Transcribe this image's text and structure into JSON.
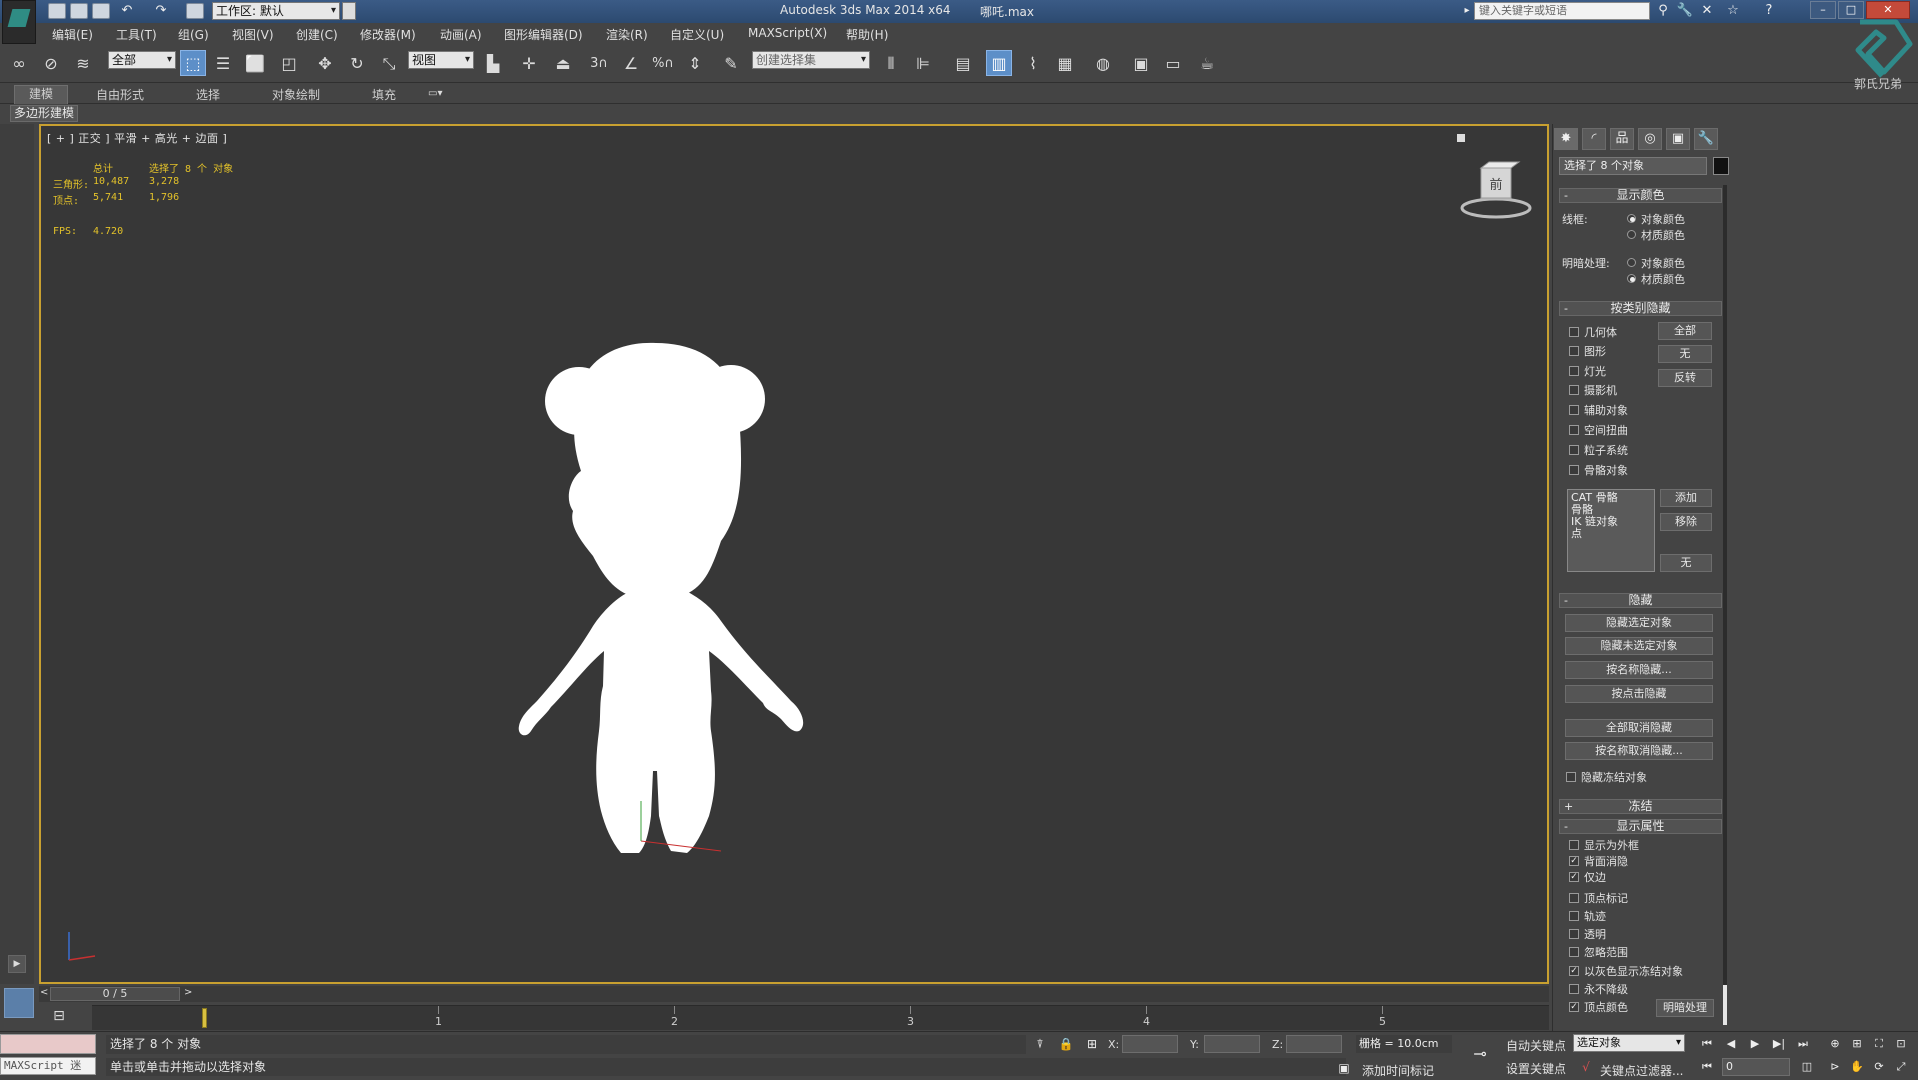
{
  "titlebar": {
    "workspace": "工作区: 默认",
    "app_title": "Autodesk 3ds Max  2014 x64",
    "file_name": "哪吒.max",
    "search_placeholder": "键入关键字或短语"
  },
  "menu": [
    "编辑(E)",
    "工具(T)",
    "组(G)",
    "视图(V)",
    "创建(C)",
    "修改器(M)",
    "动画(A)",
    "图形编辑器(D)",
    "渲染(R)",
    "自定义(U)",
    "MAXScript(X)",
    "帮助(H)"
  ],
  "toolbar": {
    "filter": "全部",
    "coord_system": "视图",
    "named_selection_placeholder": "创建选择集"
  },
  "ribbon": {
    "tabs": [
      "建模",
      "自由形式",
      "选择",
      "对象绘制",
      "填充"
    ],
    "subpanel": "多边形建模"
  },
  "viewport": {
    "label": "[ + ] 正交 ] 平滑 + 高光 + 边面 ]",
    "stats": {
      "header_total": "总计",
      "header_selected": "选择了 8 个 对象",
      "tri_label": "三角形:",
      "tri_total": "10,487",
      "tri_selected": "3,278",
      "vert_label": "顶点:",
      "vert_total": "5,741",
      "vert_selected": "1,796",
      "fps_label": "FPS:",
      "fps_value": "4.720"
    },
    "viewcube_label": "前"
  },
  "command_panel": {
    "selection_name": "选择了 8 个对象",
    "display_color": {
      "title": "显示颜色",
      "wire_label": "线框:",
      "shaded_label": "明暗处理:",
      "opt_object": "对象颜色",
      "opt_material": "材质颜色"
    },
    "hide_by_category": {
      "title": "按类别隐藏",
      "items": [
        "几何体",
        "图形",
        "灯光",
        "摄影机",
        "辅助对象",
        "空间扭曲",
        "粒子系统",
        "骨骼对象"
      ],
      "btn_all": "全部",
      "btn_none": "无",
      "btn_invert": "反转",
      "list": [
        "CAT 骨骼",
        "骨骼",
        "IK 链对象",
        "点"
      ],
      "btn_add": "添加",
      "btn_remove": "移除",
      "btn_none2": "无"
    },
    "hide": {
      "title": "隐藏",
      "buttons": [
        "隐藏选定对象",
        "隐藏未选定对象",
        "按名称隐藏...",
        "按点击隐藏",
        "全部取消隐藏",
        "按名称取消隐藏..."
      ],
      "hide_frozen": "隐藏冻结对象"
    },
    "freeze": {
      "title": "冻结"
    },
    "display_props": {
      "title": "显示属性",
      "items": [
        {
          "label": "显示为外框",
          "checked": false
        },
        {
          "label": "背面消隐",
          "checked": true
        },
        {
          "label": "仅边",
          "checked": true
        },
        {
          "label": "顶点标记",
          "checked": false
        },
        {
          "label": "轨迹",
          "checked": false
        },
        {
          "label": "透明",
          "checked": false
        },
        {
          "label": "忽略范围",
          "checked": false
        },
        {
          "label": "以灰色显示冻结对象",
          "checked": true
        },
        {
          "label": "永不降级",
          "checked": false
        },
        {
          "label": "顶点颜色",
          "checked": true
        }
      ],
      "shaded_button": "明暗处理"
    }
  },
  "timeline": {
    "slider": "0 / 5",
    "ticks": [
      "1",
      "2",
      "3",
      "4",
      "5"
    ],
    "current_fraction": 0
  },
  "status": {
    "maxscript": "MAXScript 迷",
    "line1": "选择了 8 个 对象",
    "line2": "单击或单击并拖动以选择对象",
    "x_label": "X:",
    "y_label": "Y:",
    "z_label": "Z:",
    "grid": "栅格 = 10.0cm",
    "add_time_tag": "添加时间标记",
    "auto_key": "自动关键点",
    "set_key": "设置关键点",
    "key_mode": "选定对象",
    "key_filters": "关键点过滤器...",
    "frame": "0"
  },
  "watermark": "郭氏兄弟"
}
